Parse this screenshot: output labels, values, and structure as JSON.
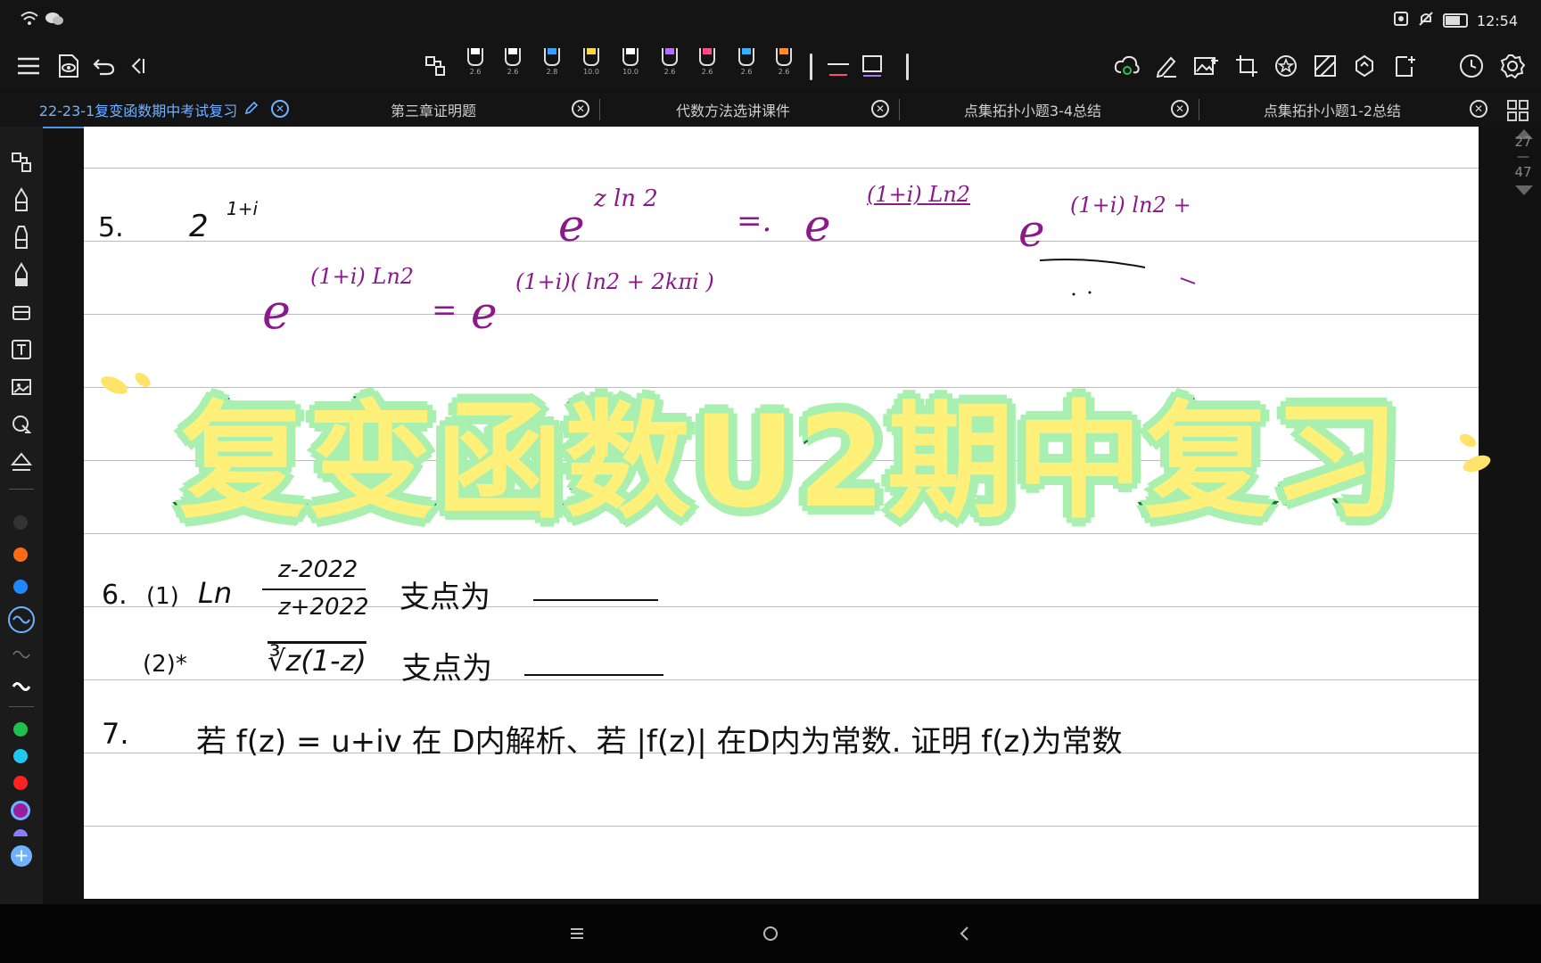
{
  "status": {
    "time": "12:54"
  },
  "toolbar": {
    "pens": [
      {
        "size": "2.6",
        "color": "#ffffff"
      },
      {
        "size": "2.6",
        "color": "#ffffff"
      },
      {
        "size": "2.8",
        "color": "#3aa0ff"
      },
      {
        "size": "10.0",
        "color": "#ffd84a"
      },
      {
        "size": "10.0",
        "color": "#ffffff"
      },
      {
        "size": "2.6",
        "color": "#b070ff"
      },
      {
        "size": "2.6",
        "color": "#ff4d8a"
      },
      {
        "size": "2.6",
        "color": "#39b0ff"
      },
      {
        "size": "2.6",
        "color": "#ff8c2e"
      }
    ]
  },
  "tabs": {
    "active": "22-23-1复变函数期中考试复习",
    "t2": "第三章证明题",
    "t3": "代数方法选讲课件",
    "t4": "点集拓扑小题3-4总结",
    "t5": "点集拓扑小题1-2总结"
  },
  "rail": {
    "page": "27",
    "sep": "—",
    "total": "47"
  },
  "palette": {
    "colors": [
      "#333333",
      "#ff6a13",
      "#1e88ff",
      "#6fb1ff",
      "#777777",
      "#ffffff",
      "#1fc04d",
      "#1ec8f0",
      "#ff2222",
      "#9a1e9a",
      "#8a7cff"
    ]
  },
  "notes": {
    "q5_num": "5.",
    "q5_expr": "2",
    "q5_exp": "1+i",
    "line1_a": "e",
    "line1_a_exp": "z ln 2",
    "line1_eq": "=.",
    "line1_b": "e",
    "line1_b_exp": "(1+i) Ln2",
    "line1_c": "e",
    "line1_c_exp": "(1+i) ln2 +",
    "line2_a": "e",
    "line2_a_exp": "(1+i) Ln2",
    "line2_eq": "=",
    "line2_b": "e",
    "line2_b_exp": "(1+i)( ln2 + 2kπi )",
    "q6_num": "6.",
    "q6_part1": "(1)",
    "q6_ln": "Ln",
    "q6_num_frac": "z-2022",
    "q6_den_frac": "z+2022",
    "q6_text1": "支点为",
    "q6_part2": "(2)*",
    "q6_root": "∛z(1-z)",
    "q6_text2": "支点为",
    "q7_num": "7.",
    "q7_text": "若  f(z) = u+iv 在 D内解析、若 |f(z)| 在D内为常数. 证明 f(z)为常数"
  },
  "overlay": {
    "title": "复变函数U2期中复习"
  }
}
